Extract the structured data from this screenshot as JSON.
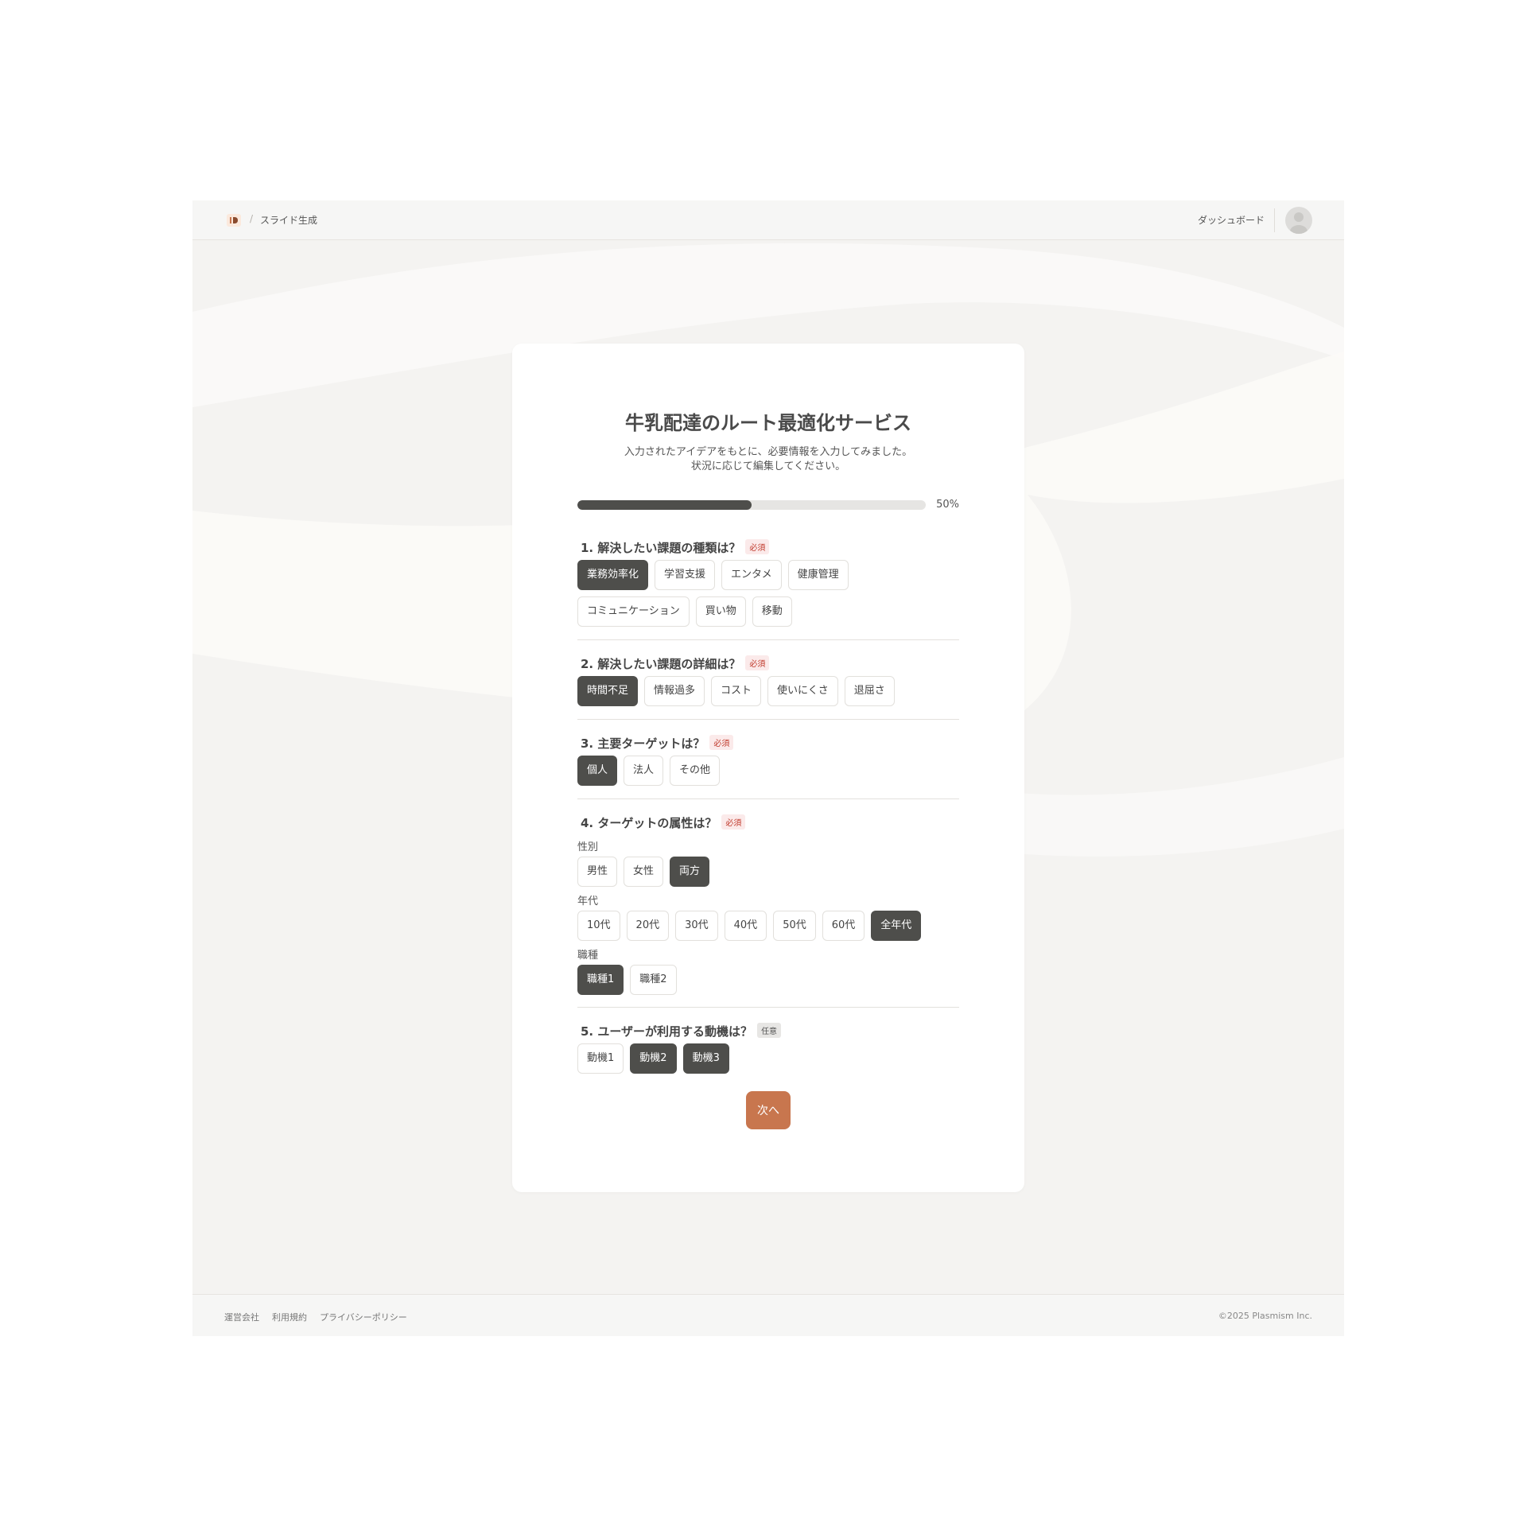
{
  "header": {
    "breadcrumb_sep": "/",
    "current_page": "スライド生成",
    "dashboard_label": "ダッシュボード"
  },
  "card": {
    "title": "牛乳配達のルート最適化サービス",
    "subtitle_line1": "入力されたアイデアをもとに、必要情報を入力してみました。",
    "subtitle_line2": "状況に応じて編集してください。",
    "progress_percent": 50,
    "progress_label": "50%"
  },
  "questions": [
    {
      "title": "1. 解決したい課題の種類は？",
      "badge": "必須",
      "rows": [
        [
          {
            "label": "業務効率化",
            "selected": true
          },
          {
            "label": "学習支援",
            "selected": false
          },
          {
            "label": "エンタメ",
            "selected": false
          },
          {
            "label": "健康管理",
            "selected": false
          }
        ],
        [
          {
            "label": "コミュニケーション",
            "selected": false
          },
          {
            "label": "買い物",
            "selected": false
          },
          {
            "label": "移動",
            "selected": false
          }
        ]
      ]
    },
    {
      "title": "2. 解決したい課題の詳細は？",
      "badge": "必須",
      "rows": [
        [
          {
            "label": "時間不足",
            "selected": true
          },
          {
            "label": "情報過多",
            "selected": false
          },
          {
            "label": "コスト",
            "selected": false
          },
          {
            "label": "使いにくさ",
            "selected": false
          },
          {
            "label": "退屈さ",
            "selected": false
          }
        ]
      ]
    },
    {
      "title": "3. 主要ターゲットは？",
      "badge": "必須",
      "rows": [
        [
          {
            "label": "個人",
            "selected": true
          },
          {
            "label": "法人",
            "selected": false
          },
          {
            "label": "その他",
            "selected": false
          }
        ]
      ]
    },
    {
      "title": "4. ターゲットの属性は？",
      "badge": "必須",
      "groups": [
        {
          "label": "性別",
          "options": [
            {
              "label": "男性",
              "selected": false
            },
            {
              "label": "女性",
              "selected": false
            },
            {
              "label": "両方",
              "selected": true
            }
          ]
        },
        {
          "label": "年代",
          "options": [
            {
              "label": "10代",
              "selected": false
            },
            {
              "label": "20代",
              "selected": false
            },
            {
              "label": "30代",
              "selected": false
            },
            {
              "label": "40代",
              "selected": false
            },
            {
              "label": "50代",
              "selected": false
            },
            {
              "label": "60代",
              "selected": false
            },
            {
              "label": "全年代",
              "selected": true
            }
          ]
        },
        {
          "label": "職種",
          "options": [
            {
              "label": "職種1",
              "selected": true
            },
            {
              "label": "職種2",
              "selected": false
            }
          ]
        }
      ]
    },
    {
      "title": "5. ユーザーが利用する動機は？",
      "badge": "任意",
      "rows": [
        [
          {
            "label": "動機1",
            "selected": false
          },
          {
            "label": "動機2",
            "selected": true
          },
          {
            "label": "動機3",
            "selected": true
          }
        ]
      ]
    }
  ],
  "next_label": "次へ",
  "footer": {
    "links": [
      "運営会社",
      "利用規約",
      "プライバシーポリシー"
    ],
    "copyright": "©2025 Plasmism Inc."
  },
  "colors": {
    "accent": "#c8764e",
    "selected_chip": "#4e4e4b",
    "required_badge": "#c0392b"
  }
}
